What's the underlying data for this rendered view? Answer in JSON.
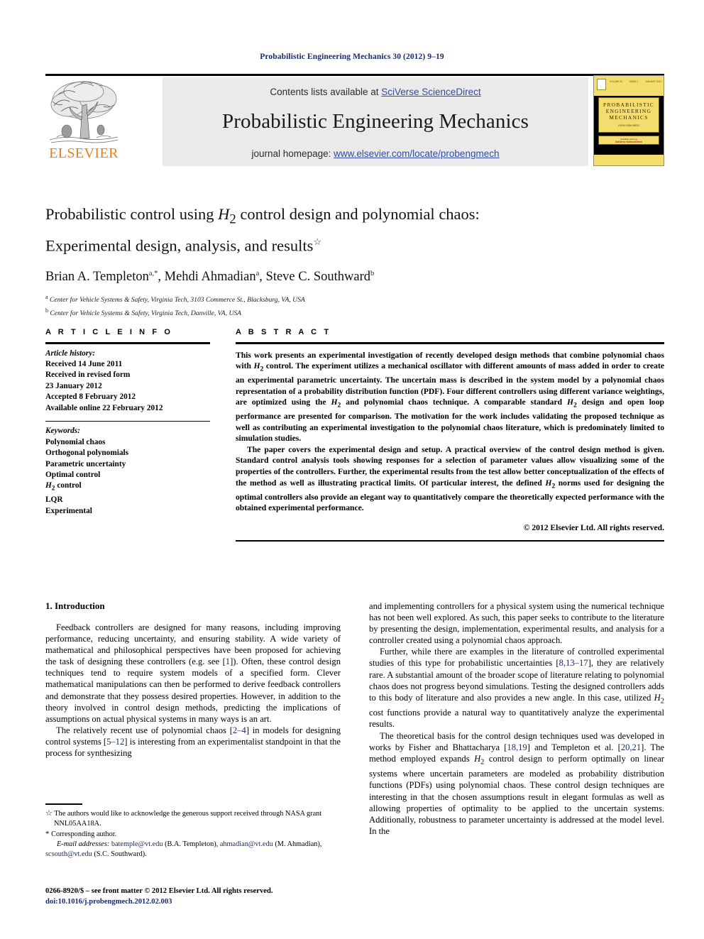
{
  "running_head": "Probabilistic Engineering Mechanics 30 (2012) 9–19",
  "masthead": {
    "contents_prefix": "Contents lists available at ",
    "contents_link": "SciVerse ScienceDirect",
    "journal_title": "Probabilistic Engineering Mechanics",
    "homepage_prefix": "journal homepage: ",
    "homepage_link": "www.elsevier.com/locate/probengmech",
    "publisher": "ELSEVIER",
    "link_color": "#2f4ca0",
    "panel_color": "#eaeaea"
  },
  "cover": {
    "vol_left": "VOLUME 30",
    "vol_mid": "ISSUE 1",
    "vol_right": "JANUARY 2012",
    "title_line1": "PROBABILISTIC",
    "title_line2": "ENGINEERING",
    "title_line3": "MECHANICS",
    "issn": "ISSN 0266-8920",
    "band_line1": "Available online at",
    "band_line2": "SciVerse ScienceDirect",
    "accent_yellow": "#f5dd6d"
  },
  "title": {
    "line1_a": "Probabilistic control using ",
    "line1_h": "H",
    "line1_sub": "2",
    "line1_b": " control design and polynomial chaos:",
    "line2": "Experimental design, analysis, and results",
    "star": "☆"
  },
  "authors": {
    "a1_name": "Brian A. Templeton",
    "a1_sup": "a,*",
    "sep1": ", ",
    "a2_name": "Mehdi Ahmadian",
    "a2_sup": "a",
    "sep2": ", ",
    "a3_name": "Steve C. Southward",
    "a3_sup": "b"
  },
  "affiliations": [
    {
      "marker": "a",
      "text": "Center for Vehicle Systems & Safety, Virginia Tech, 3103 Commerce St., Blacksburg, VA, USA"
    },
    {
      "marker": "b",
      "text": "Center for Vehicle Systems & Safety, Virginia Tech, Danville, VA, USA"
    }
  ],
  "article_info": {
    "heading": "A R T I C L E   I N F O",
    "history_label": "Article history:",
    "history": [
      "Received 14 June 2011",
      "Received in revised form",
      "23 January 2012",
      "Accepted 8 February 2012",
      "Available online 22 February 2012"
    ],
    "keywords_label": "Keywords:",
    "keywords": [
      "Polynomial chaos",
      "Orthogonal polynomials",
      "Parametric uncertainty",
      "Optimal control",
      "H2 control",
      "LQR",
      "Experimental"
    ],
    "keyword_h2_prefix": "H",
    "keyword_h2_sub": "2",
    "keyword_h2_suffix": " control"
  },
  "abstract": {
    "heading": "A B S T R A C T",
    "p1_s1": "This work presents an experimental investigation of recently developed design methods that combine polynomial chaos with ",
    "p1_s2": " control. The experiment utilizes a mechanical oscillator with different amounts of mass added in order to create an experimental parametric uncertainty. The uncertain mass is described in the system model by a polynomial chaos representation of a probability distribution function (PDF). Four different controllers using different variance weightings, are optimized using the ",
    "p1_s3": " and polynomial chaos technique. A comparable standard ",
    "p1_s4": " design and open loop performance are presented for comparison. The motivation for the work includes validating the proposed technique as well as contributing an experimental investigation to the polynomial chaos literature, which is predominately limited to simulation studies.",
    "p2_s1": "The paper covers the experimental design and setup. A practical overview of the control design method is given. Standard control analysis tools showing responses for a selection of parameter values allow visualizing some of the properties of the controllers. Further, the experimental results from the test allow better conceptualization of the effects of the method as well as illustrating practical limits. Of particular interest, the defined ",
    "p2_s2": " norms used for designing the optimal controllers also provide an elegant way to quantitatively compare the theoretically expected performance with the obtained experimental performance.",
    "copyright": "© 2012 Elsevier Ltd. All rights reserved."
  },
  "body": {
    "section_heading": "1. Introduction",
    "left": {
      "p1": "Feedback controllers are designed for many reasons, including improving performance, reducing uncertainty, and ensuring stability. A wide variety of mathematical and philosophical perspectives have been proposed for achieving the task of designing these controllers (e.g. see [1]). Often, these control design techniques tend to require system models of a specified form. Clever mathematical manipulations can then be performed to derive feedback controllers and demonstrate that they possess desired properties. However, in addition to the theory involved in control design methods, predicting the implications of assumptions on actual physical systems in many ways is an art.",
      "p1_ref1": "1",
      "p2_a": "The relatively recent use of polynomial chaos [",
      "p2_ref1": "2–4",
      "p2_b": "] in models for designing control systems [",
      "p2_ref2": "5–12",
      "p2_c": "] is interesting from an experimentalist standpoint in that the process for synthesizing"
    },
    "right": {
      "p1": "and implementing controllers for a physical system using the numerical technique has not been well explored. As such, this paper seeks to contribute to the literature by presenting the design, implementation, experimental results, and analysis for a controller created using a polynomial chaos approach.",
      "p2_a": "Further, while there are examples in the literature of controlled experimental studies of this type for probabilistic uncertainties [",
      "p2_ref1": "8,13–17",
      "p2_b": "], they are relatively rare. A substantial amount of the broader scope of literature relating to polynomial chaos does not progress beyond simulations. Testing the designed controllers adds to this body of literature and also provides a new angle. In this case, utilized ",
      "p2_c": " cost functions provide a natural way to quantitatively analyze the experimental results.",
      "p3_a": "The theoretical basis for the control design techniques used was developed in works by Fisher and Bhattacharya [",
      "p3_ref1": "18,19",
      "p3_b": "] and Templeton et al. [",
      "p3_ref2": "20,21",
      "p3_c": "]. The method employed expands ",
      "p3_d": " control design to perform optimally on linear systems where uncertain parameters are modeled as probability distribution functions (PDFs) using polynomial chaos. These control design techniques are interesting in that the chosen assumptions result in elegant formulas as well as allowing properties of optimality to be applied to the uncertain systems. Additionally, robustness to parameter uncertainty is addressed at the model level. In the"
    }
  },
  "footnotes": {
    "fn1_marker": "☆",
    "fn1_text": "The authors would like to acknowledge the generous support received through NASA grant NNL05AA18A.",
    "fn2_marker": "*",
    "fn2_text": "Corresponding author.",
    "email_label": "E-mail addresses:",
    "email1": "batemple@vt.edu",
    "email1_who": " (B.A. Templeton), ",
    "email2": "ahmadian@vt.edu",
    "email2_who": " (M. Ahmadian), ",
    "email3": "scsouth@vt.edu",
    "email3_who": " (S.C. Southward).",
    "issn_line": "0266-8920/$ – see front matter © 2012 Elsevier Ltd. All rights reserved.",
    "doi_line": "doi:10.1016/j.probengmech.2012.02.003"
  }
}
